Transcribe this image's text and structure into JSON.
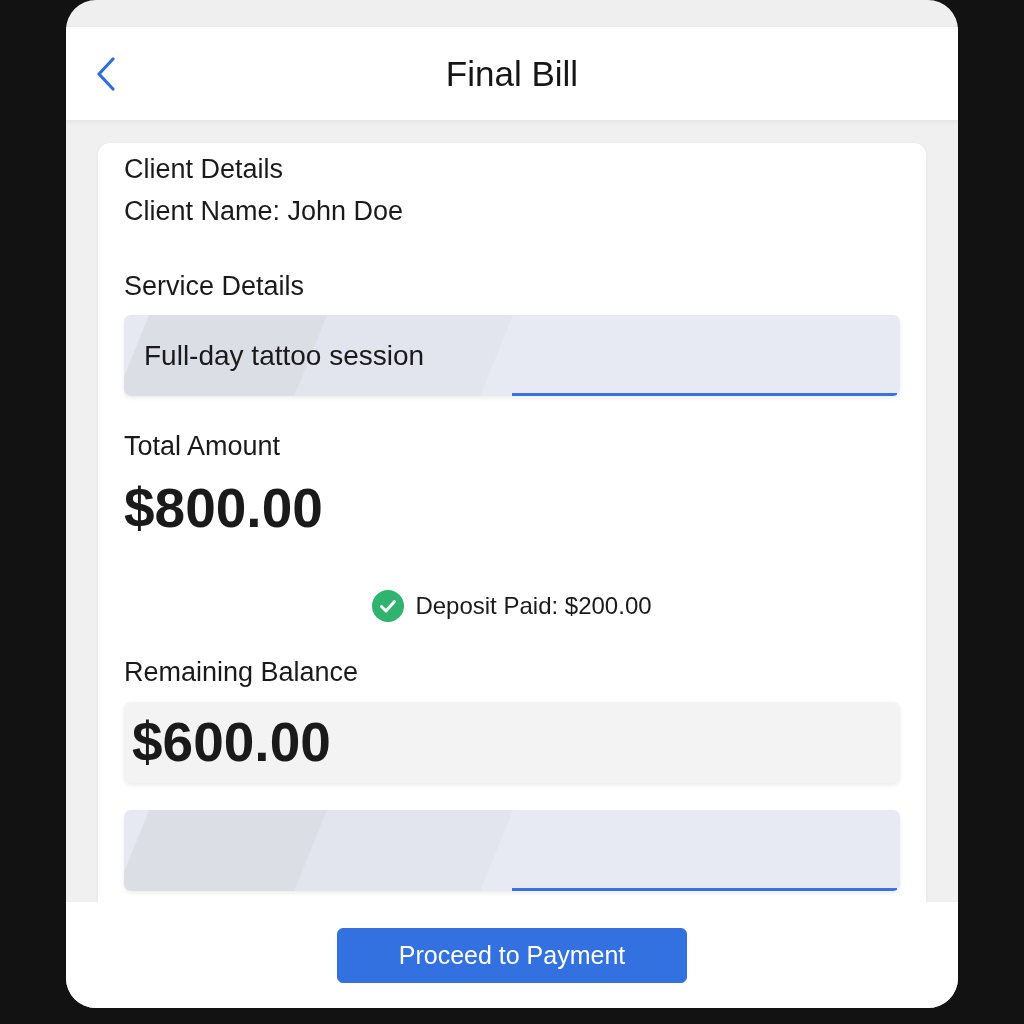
{
  "header": {
    "title": "Final Bill"
  },
  "card": {
    "items": [
      {
        "kind": "heading",
        "text": "Client Details"
      },
      {
        "kind": "text",
        "text": "Client Name: John Doe"
      },
      {
        "kind": "heading",
        "text": "Service Details"
      },
      {
        "kind": "field",
        "value": "Full-day tattoo session"
      },
      {
        "kind": "heading",
        "text": "Total Amount"
      },
      {
        "kind": "amount",
        "text": "$800.00"
      },
      {
        "kind": "status",
        "text": "Deposit Paid: $200.00"
      },
      {
        "kind": "heading",
        "text": "Remaining Balance"
      },
      {
        "kind": "amount_box",
        "text": "$600.00"
      },
      {
        "kind": "field"
      }
    ]
  },
  "footer": {
    "button": "Proceed to Payment"
  }
}
